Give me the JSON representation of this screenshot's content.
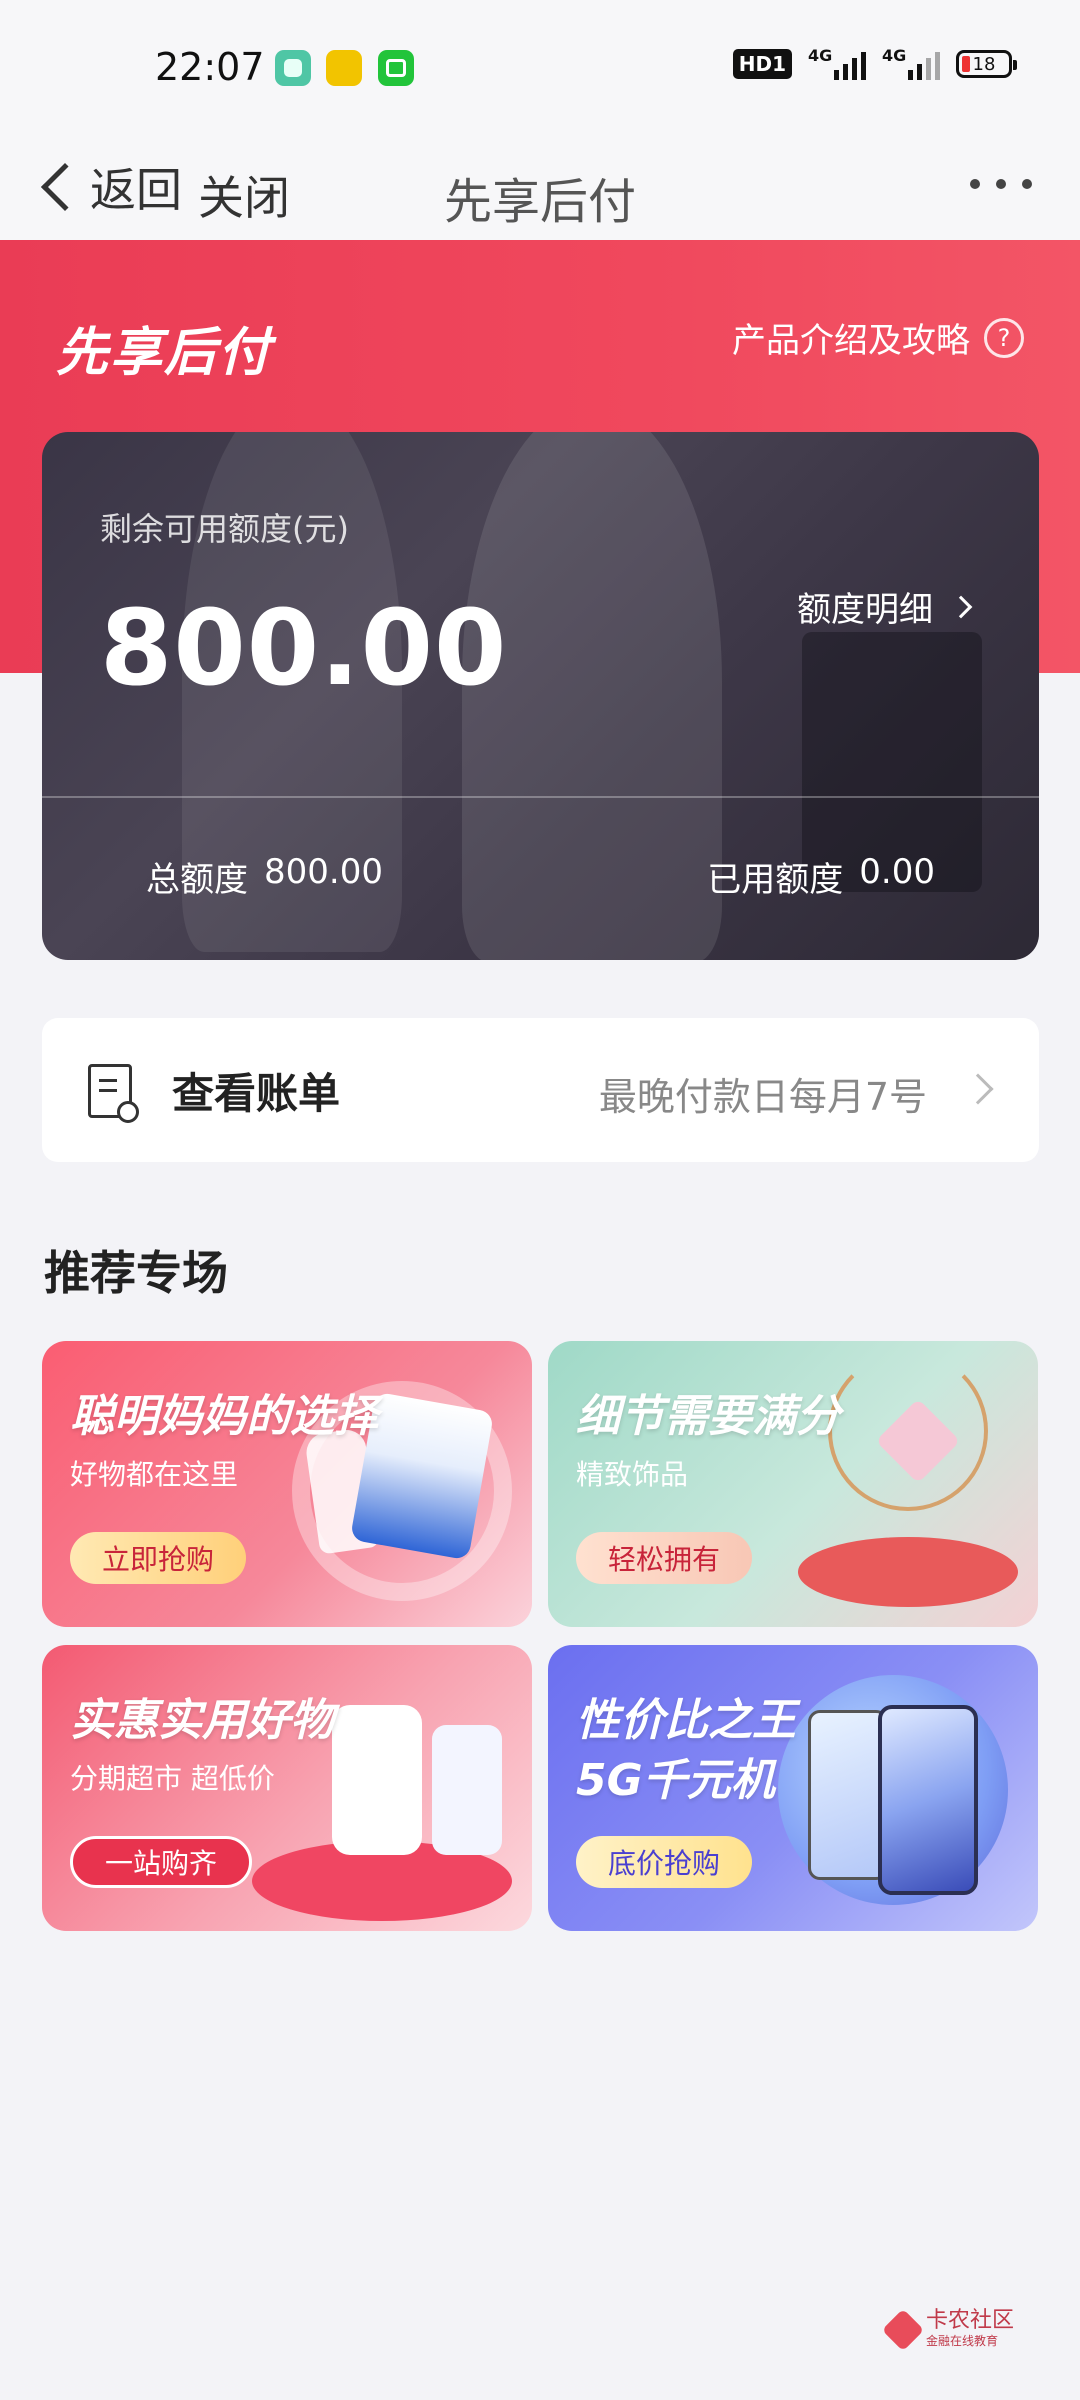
{
  "status_bar": {
    "time": "22:07",
    "network_badge": "HD1",
    "signal1_label": "4G",
    "signal2_label": "4G",
    "battery_level": "18",
    "app_icons": [
      "notes-app-icon",
      "yellow-app-icon",
      "iqiyi-icon"
    ]
  },
  "nav": {
    "back_label": "返回",
    "close_label": "关闭",
    "title": "先享后付"
  },
  "hero": {
    "logo_text": "先享后付",
    "guide_label": "产品介绍及攻略",
    "help_symbol": "?"
  },
  "credit": {
    "remaining_label": "剩余可用额度(元)",
    "remaining_amount": "800.00",
    "detail_label": "额度明细",
    "total_label": "总额度",
    "total_amount": "800.00",
    "used_label": "已用额度",
    "used_amount": "0.00"
  },
  "bill": {
    "title": "查看账单",
    "due_note": "最晚付款日每月7号"
  },
  "recommend": {
    "section_title": "推荐专场",
    "banners": [
      {
        "title": "聪明妈妈的选择",
        "subtitle": "好物都在这里",
        "button": "立即抢购"
      },
      {
        "title": "细节需要满分",
        "subtitle": "精致饰品",
        "button": "轻松拥有"
      },
      {
        "title": "实惠实用好物",
        "subtitle": "分期超市 超低价",
        "button": "一站购齐"
      },
      {
        "title_line1": "性价比之王",
        "title_line2": "5G千元机",
        "button": "底价抢购"
      }
    ]
  },
  "watermark": {
    "text": "卡农社区",
    "sub": "金融在线教育"
  },
  "colors": {
    "brand_red": "#f0485d",
    "background": "#f3f3f7",
    "card_dark": "#3a3546"
  }
}
